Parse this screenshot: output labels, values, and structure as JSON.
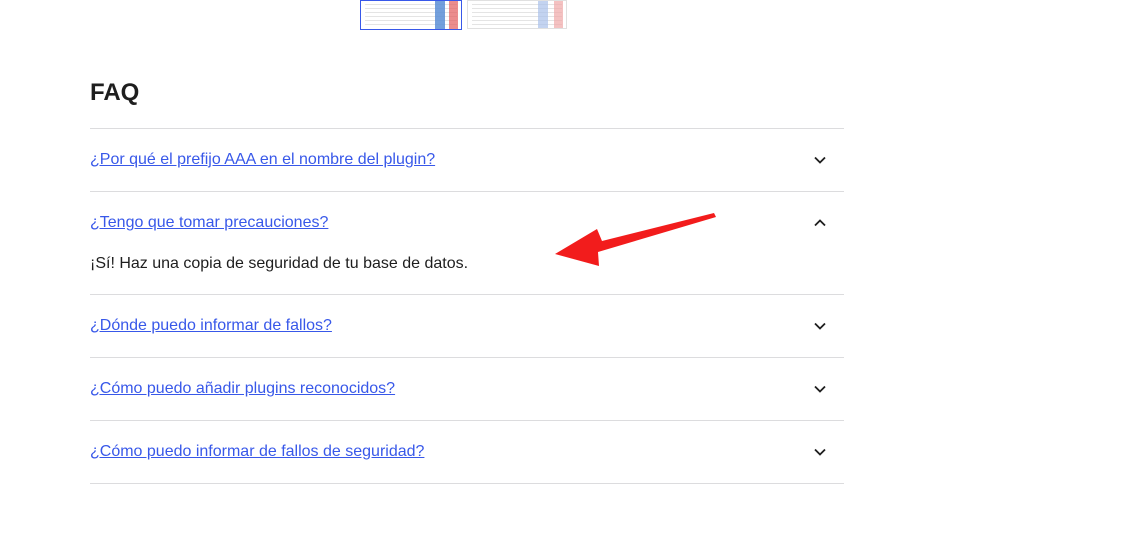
{
  "faq": {
    "title": "FAQ",
    "items": [
      {
        "question": "¿Por qué el prefijo AAA en el nombre del plugin?",
        "expanded": false,
        "icon": "chevron-down-icon"
      },
      {
        "question": "¿Tengo que tomar precauciones?",
        "expanded": true,
        "answer": "¡Sí! Haz una copia de seguridad de tu base de datos.",
        "icon": "chevron-up-icon"
      },
      {
        "question": "¿Dónde puedo informar de fallos?",
        "expanded": false,
        "icon": "chevron-down-icon"
      },
      {
        "question": "¿Cómo puedo añadir plugins reconocidos?",
        "expanded": false,
        "icon": "chevron-down-icon"
      },
      {
        "question": "¿Cómo puedo informar de fallos de seguridad?",
        "expanded": false,
        "icon": "chevron-down-icon"
      }
    ]
  },
  "colors": {
    "link": "#3858e9",
    "text": "#1e1e1e",
    "divider": "#dcdcde",
    "annotation_arrow": "#f21c1c"
  }
}
